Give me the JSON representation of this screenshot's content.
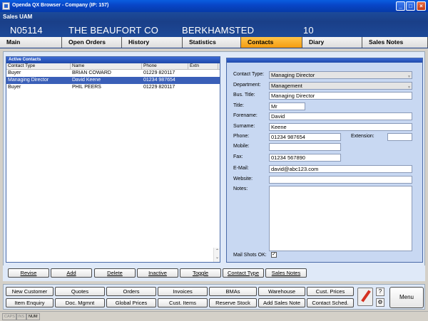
{
  "window": {
    "title": "Openda QX Browser - Company (IP: 157)"
  },
  "header": {
    "module": "Sales UAM",
    "account": "N05114",
    "company": "THE BEAUFORT CO",
    "town": "BERKHAMSTED",
    "number": "10"
  },
  "tabs": [
    {
      "label": "Main"
    },
    {
      "label": "Open Orders"
    },
    {
      "label": "History"
    },
    {
      "label": "Statistics"
    },
    {
      "label": "Contacts"
    },
    {
      "label": "Diary"
    },
    {
      "label": "Sales Notes"
    }
  ],
  "active_tab": "Contacts",
  "contacts": {
    "title": "Active Contacts",
    "columns": [
      "Contact Type",
      "Name",
      "Phone",
      "Extn"
    ],
    "rows": [
      {
        "type": "Buyer",
        "name": "BRIAN COWARD",
        "phone": "01229 820117",
        "extn": ""
      },
      {
        "type": "Managing Director",
        "name": "David Keene",
        "phone": "01234 987654",
        "extn": ""
      },
      {
        "type": "Buyer",
        "name": "PHIL PEERS",
        "phone": "01229 820117",
        "extn": ""
      }
    ],
    "selected_index": 1
  },
  "detail": {
    "contact_type_label": "Contact Type:",
    "contact_type": "Managing Director",
    "department_label": "Department:",
    "department": "Management",
    "bus_title_label": "Bus. Title:",
    "bus_title": "Managing Director",
    "title_label": "Title:",
    "title": "Mr",
    "forename_label": "Forename:",
    "forename": "David",
    "surname_label": "Surname:",
    "surname": "Keene",
    "phone_label": "Phone:",
    "phone": "01234 987654",
    "extension_label": "Extension:",
    "extension": "",
    "mobile_label": "Mobile:",
    "mobile": "",
    "fax_label": "Fax:",
    "fax": "01234 567890",
    "email_label": "E-Mail:",
    "email": "david@abc123.com",
    "website_label": "Website:",
    "website": "",
    "notes_label": "Notes:",
    "notes": "",
    "mailshots_label": "Mail Shots OK:",
    "mailshots_checked": "✓"
  },
  "actions": [
    "Revise",
    "Add",
    "Delete",
    "Inactive",
    "Toggle",
    "Contact Type",
    "Sales Notes"
  ],
  "bottom_row1": [
    "New Customer",
    "Quotes",
    "Orders",
    "Invoices",
    "BMAs",
    "Warehouse",
    "Cust. Prices"
  ],
  "bottom_row2": [
    "Item Enquiry",
    "Doc. Mgmnt",
    "Global Prices",
    "Cust. Items",
    "Reserve Stock",
    "Add Sales Note",
    "Contact Sched."
  ],
  "menu_label": "Menu",
  "status": [
    "CAPS",
    "INS",
    "NUM"
  ],
  "colors": {
    "header_blue": "#1a3f88",
    "active_tab": "#f49c10",
    "selection": "#3a5fb8"
  }
}
